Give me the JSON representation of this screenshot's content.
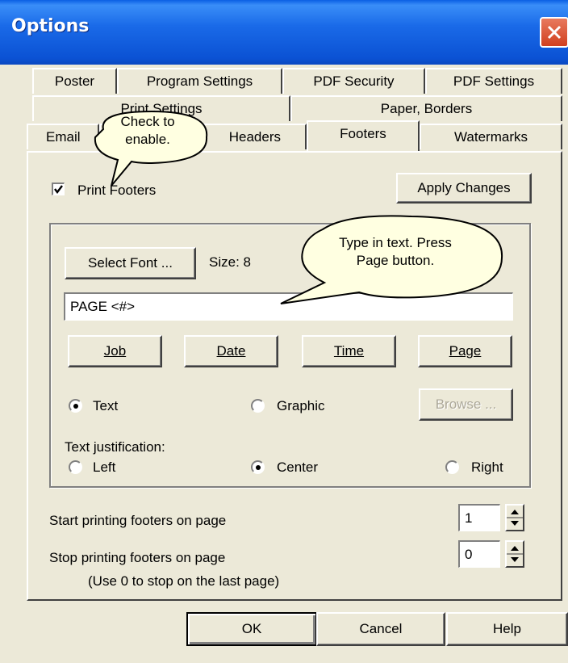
{
  "window": {
    "title": "Options"
  },
  "tabs": {
    "row1": [
      "Poster",
      "Program Settings",
      "PDF Security",
      "PDF Settings"
    ],
    "row2": [
      "Print Settings",
      "Paper, Borders"
    ],
    "row3": [
      "Email",
      "Headers",
      "Footers",
      "Watermarks"
    ],
    "active": "Footers"
  },
  "print_footers": {
    "label": "Print Footers",
    "checked": true
  },
  "apply_changes_label": "Apply Changes",
  "font": {
    "select_label": "Select Font ...",
    "size_text": "Size: 8"
  },
  "footer_text": {
    "value": "PAGE <#>"
  },
  "insert_buttons": {
    "job": "Job",
    "date": "Date",
    "time": "Time",
    "page": "Page"
  },
  "content_type": {
    "text": "Text",
    "graphic": "Graphic",
    "selected": "Text",
    "browse_label": "Browse ..."
  },
  "justification": {
    "label": "Text justification:",
    "left": "Left",
    "center": "Center",
    "right": "Right",
    "selected": "Center"
  },
  "start_page": {
    "label": "Start printing footers on page",
    "value": "1"
  },
  "stop_page": {
    "label": "Stop printing footers on page",
    "value": "0",
    "hint": "(Use 0 to stop on the last page)"
  },
  "dialog_buttons": {
    "ok": "OK",
    "cancel": "Cancel",
    "help": "Help"
  },
  "callouts": {
    "check": "Check to enable.",
    "type": "Type in text. Press Page button."
  },
  "colors": {
    "title_bar": "#0a58d8",
    "dialog_bg": "#ece9d8",
    "callout_fill": "#ffffe1",
    "close_button": "#d9532e"
  }
}
